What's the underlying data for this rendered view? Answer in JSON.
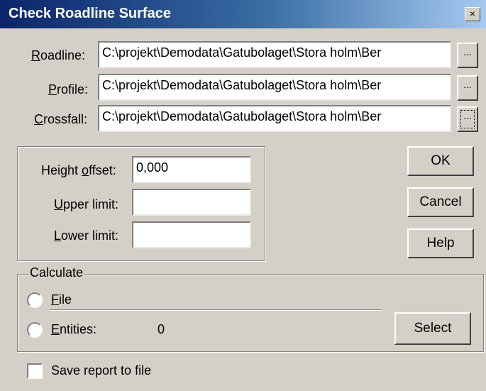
{
  "window": {
    "title": "Check Roadline Surface",
    "close_glyph": "×"
  },
  "files": {
    "roadline": {
      "label_u": "R",
      "label_rest": "oadline:",
      "value": "C:\\projekt\\Demodata\\Gatubolaget\\Stora holm\\Ber"
    },
    "profile": {
      "label_u": "P",
      "label_rest": "rofile:",
      "value": "C:\\projekt\\Demodata\\Gatubolaget\\Stora holm\\Ber"
    },
    "crossfall": {
      "label_u": "C",
      "label_rest": "rossfall:",
      "value": "C:\\projekt\\Demodata\\Gatubolaget\\Stora holm\\Ber"
    },
    "browse_label": "..."
  },
  "params": {
    "height_offset": {
      "label_pre": "Height ",
      "label_u": "o",
      "label_rest": "ffset:",
      "value": "0,000"
    },
    "upper_limit": {
      "label_u": "U",
      "label_rest": "pper limit:",
      "value": ""
    },
    "lower_limit": {
      "label_u": "L",
      "label_rest": "ower limit:",
      "value": ""
    }
  },
  "buttons": {
    "ok": "OK",
    "cancel": "Cancel",
    "help": "Help",
    "select": "Select"
  },
  "calculate": {
    "title": "Calculate",
    "file": {
      "label_u": "F",
      "label_rest": "ile"
    },
    "entities": {
      "label_u": "E",
      "label_rest": "ntities:",
      "count": "0"
    }
  },
  "save_report": {
    "label": "Save report to file",
    "checked": false
  }
}
